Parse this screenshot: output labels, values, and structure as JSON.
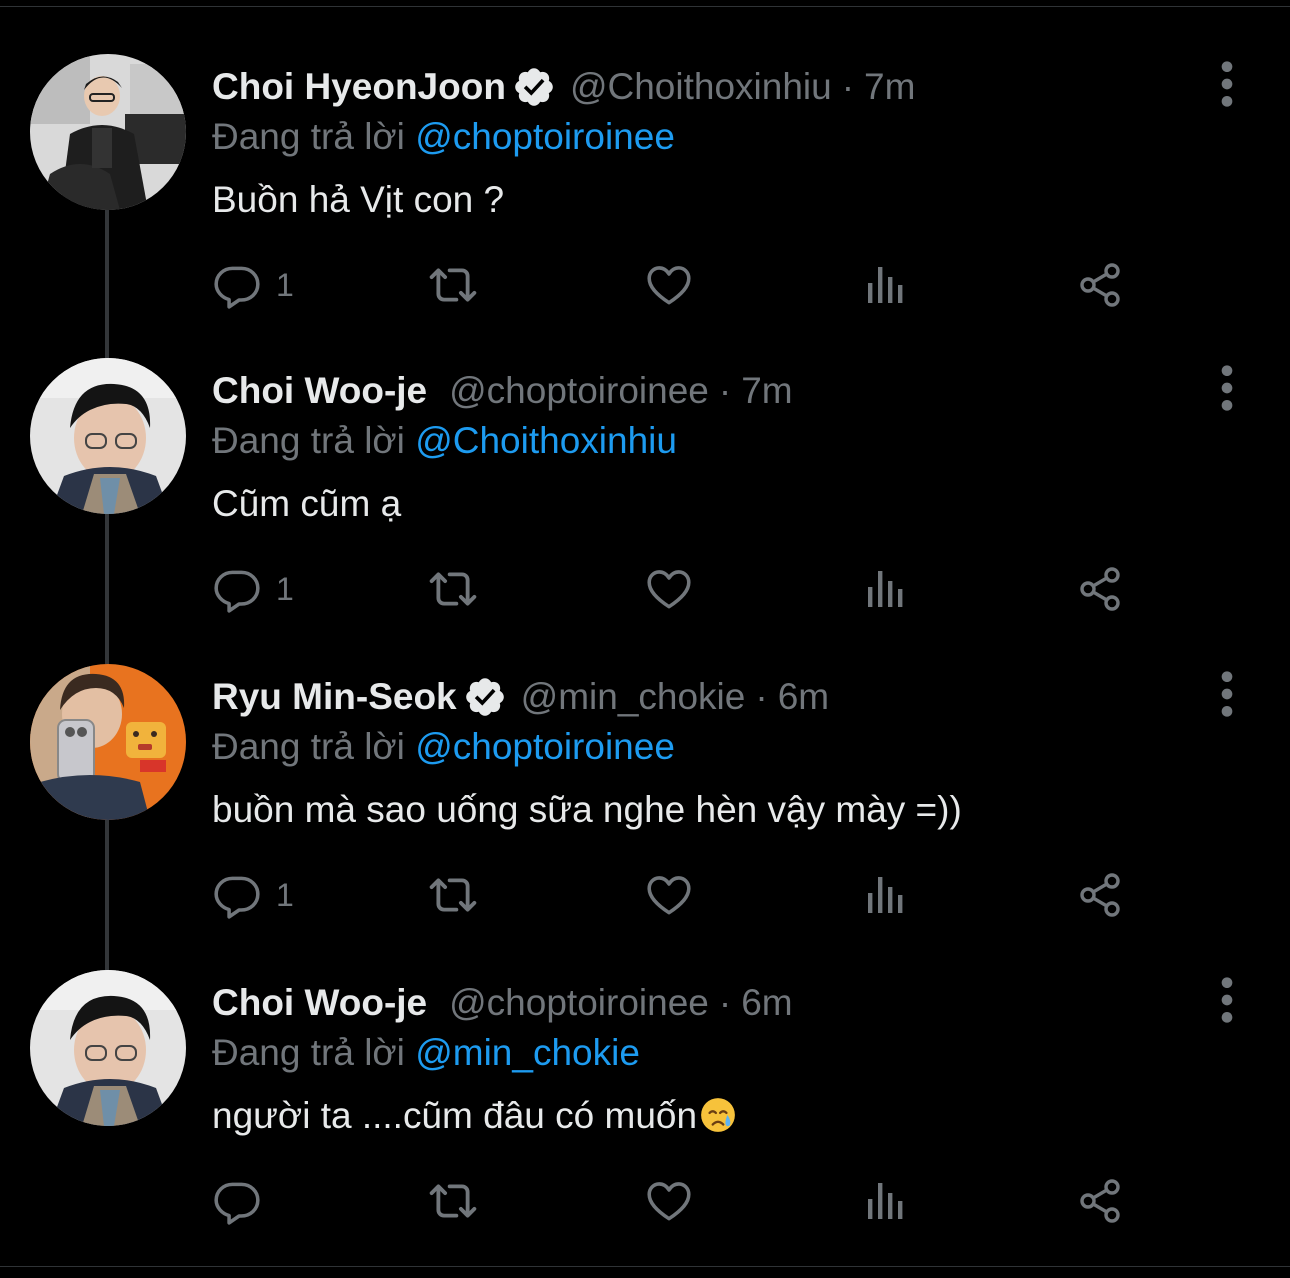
{
  "theme": {
    "background": "#000000",
    "text": "#e7e9ea",
    "muted": "#71767b",
    "link": "#1d9bf0",
    "thread_line": "#333639"
  },
  "tweets": [
    {
      "name": "Choi HyeonJoon",
      "verified": true,
      "handle": "@Choithoxinhiu",
      "separator": "·",
      "time": "7m",
      "reply_prefix": "Đang trả lời",
      "reply_to": "@choptoiroinee",
      "text": "Buồn hả Vịt con ?",
      "reply_count": "1",
      "icons": [
        "reply-icon",
        "retweet-icon",
        "like-icon",
        "views-icon",
        "share-icon",
        "more-icon"
      ]
    },
    {
      "name": "Choi Woo-je",
      "verified": false,
      "handle": "@choptoiroinee",
      "separator": "·",
      "time": "7m",
      "reply_prefix": "Đang trả lời",
      "reply_to": "@Choithoxinhiu",
      "text": "Cũm cũm ạ",
      "reply_count": "1",
      "icons": [
        "reply-icon",
        "retweet-icon",
        "like-icon",
        "views-icon",
        "share-icon",
        "more-icon"
      ]
    },
    {
      "name": "Ryu Min-Seok",
      "verified": true,
      "handle": "@min_chokie",
      "separator": "·",
      "time": "6m",
      "reply_prefix": "Đang trả lời",
      "reply_to": "@choptoiroinee",
      "text": "buồn mà sao uống sữa nghe hèn vậy mày =))",
      "reply_count": "1",
      "icons": [
        "reply-icon",
        "retweet-icon",
        "like-icon",
        "views-icon",
        "share-icon",
        "more-icon"
      ]
    },
    {
      "name": "Choi Woo-je",
      "verified": false,
      "handle": "@choptoiroinee",
      "separator": "·",
      "time": "6m",
      "reply_prefix": "Đang trả lời",
      "reply_to": "@min_chokie",
      "text": "người ta ....cũm đâu có muốn",
      "text_emoji": "crying-face-emoji",
      "reply_count": "",
      "icons": [
        "reply-icon",
        "retweet-icon",
        "like-icon",
        "views-icon",
        "share-icon",
        "more-icon"
      ]
    }
  ]
}
